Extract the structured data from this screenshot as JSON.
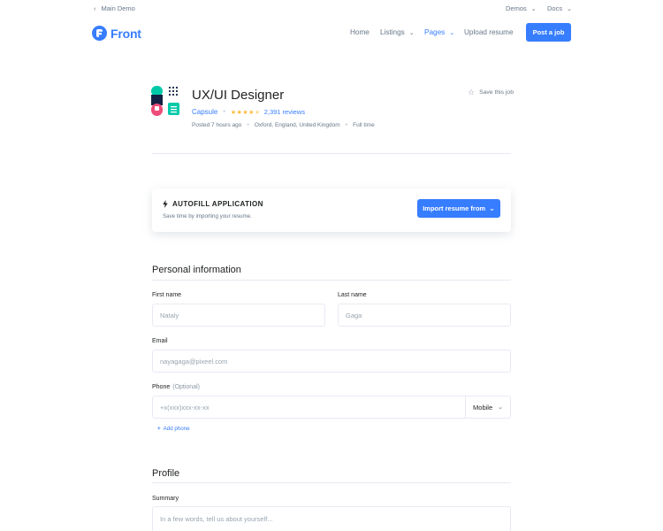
{
  "topbar": {
    "back_label": "Main Demo",
    "demos_label": "Demos",
    "docs_label": "Docs"
  },
  "nav": {
    "brand": "Front",
    "items": [
      {
        "label": "Home"
      },
      {
        "label": "Listings"
      },
      {
        "label": "Pages"
      },
      {
        "label": "Upload resume"
      }
    ],
    "cta": "Post a job"
  },
  "job": {
    "title": "UX/UI Designer",
    "company": "Capsule",
    "rating": 4.5,
    "reviews": "2,391 reviews",
    "posted": "Posted 7 hours ago",
    "location": "Oxford, England, United Kingdom",
    "type": "Full time",
    "save_label": "Save this job"
  },
  "autofill": {
    "title": "AUTOFILL APPLICATION",
    "subtitle": "Save time by importing your resume.",
    "button": "Import resume from"
  },
  "personal": {
    "heading": "Personal information",
    "first_name_label": "First name",
    "first_name_placeholder": "Nataly",
    "last_name_label": "Last name",
    "last_name_placeholder": "Gaga",
    "email_label": "Email",
    "email_placeholder": "nayagaga@pixeel.com",
    "phone_label": "Phone",
    "phone_optional": "(Optional)",
    "phone_placeholder": "+x(xxx)xxx-xx-xx",
    "phone_type": "Mobile",
    "add_phone": "Add phone"
  },
  "profile": {
    "heading": "Profile",
    "summary_label": "Summary",
    "summary_placeholder": "In a few words, tell us about yourself..."
  },
  "colors": {
    "accent": "#377dff",
    "star": "#fdb935",
    "muted": "#677788"
  }
}
